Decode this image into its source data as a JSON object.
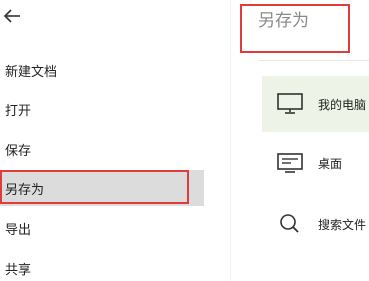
{
  "nav": {
    "back_icon": "arrow-left-icon",
    "items": [
      {
        "label": "新建文档"
      },
      {
        "label": "打开"
      },
      {
        "label": "保存"
      },
      {
        "label": "另存为",
        "selected": true
      },
      {
        "label": "导出"
      },
      {
        "label": "共享"
      }
    ]
  },
  "panel": {
    "title": "另存为",
    "locations": [
      {
        "label": "我的电脑",
        "icon": "computer-icon",
        "selected": true
      },
      {
        "label": "桌面",
        "icon": "desktop-icon"
      },
      {
        "label": "搜索文件",
        "icon": "search-icon"
      }
    ]
  },
  "colors": {
    "highlight_border": "#e23b3b",
    "nav_selected_bg": "#dcdcdc",
    "location_selected_bg": "#edf3e6",
    "title_text": "#8a8a8a"
  }
}
